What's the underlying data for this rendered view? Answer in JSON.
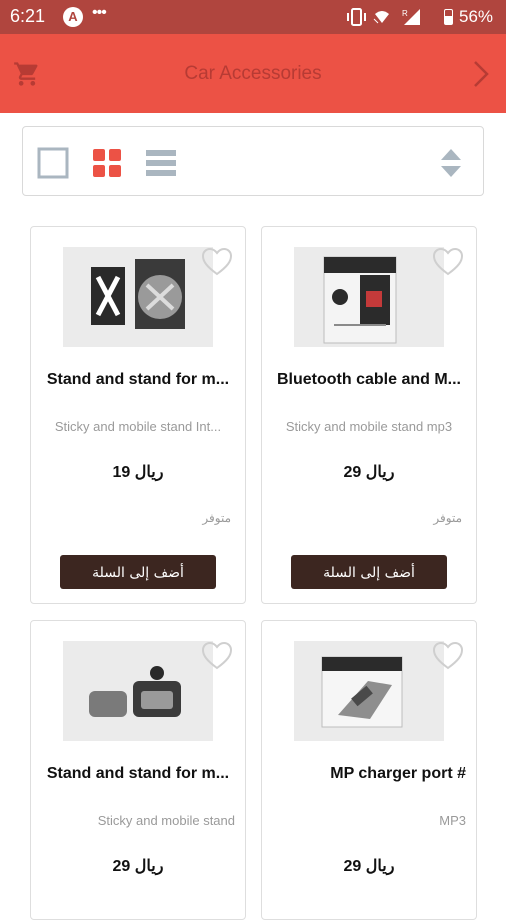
{
  "status_bar": {
    "time": "6:21",
    "notification_badge": "A",
    "dots": "•••",
    "battery_percent": "56%",
    "icons": [
      "vibrate-icon",
      "wifi-icon",
      "signal-icon",
      "battery-icon"
    ]
  },
  "header": {
    "title": "Car Accessories",
    "left_icon": "cart-icon",
    "right_icon": "chevron-right-icon",
    "color": "#ec5245"
  },
  "view_switcher": {
    "options": [
      "single-view",
      "grid-view",
      "list-view"
    ],
    "selected": "grid-view",
    "sort_icon": "sort-icon"
  },
  "products": [
    {
      "title": "Stand and stand for m...",
      "description": "Sticky and mobile stand  Int...",
      "price": "19 ريال",
      "stock": "متوفر",
      "button": "أضف إلى السلة"
    },
    {
      "title": "Bluetooth cable and M...",
      "description": "Sticky and mobile stand  mp3",
      "price": "29 ريال",
      "stock": "متوفر",
      "button": "أضف إلى السلة"
    },
    {
      "title": "Stand and stand for m...",
      "description": "Sticky and mobile stand",
      "price": "29 ريال"
    },
    {
      "title": "MP charger port #",
      "description": "MP3",
      "price": "29 ريال"
    }
  ]
}
